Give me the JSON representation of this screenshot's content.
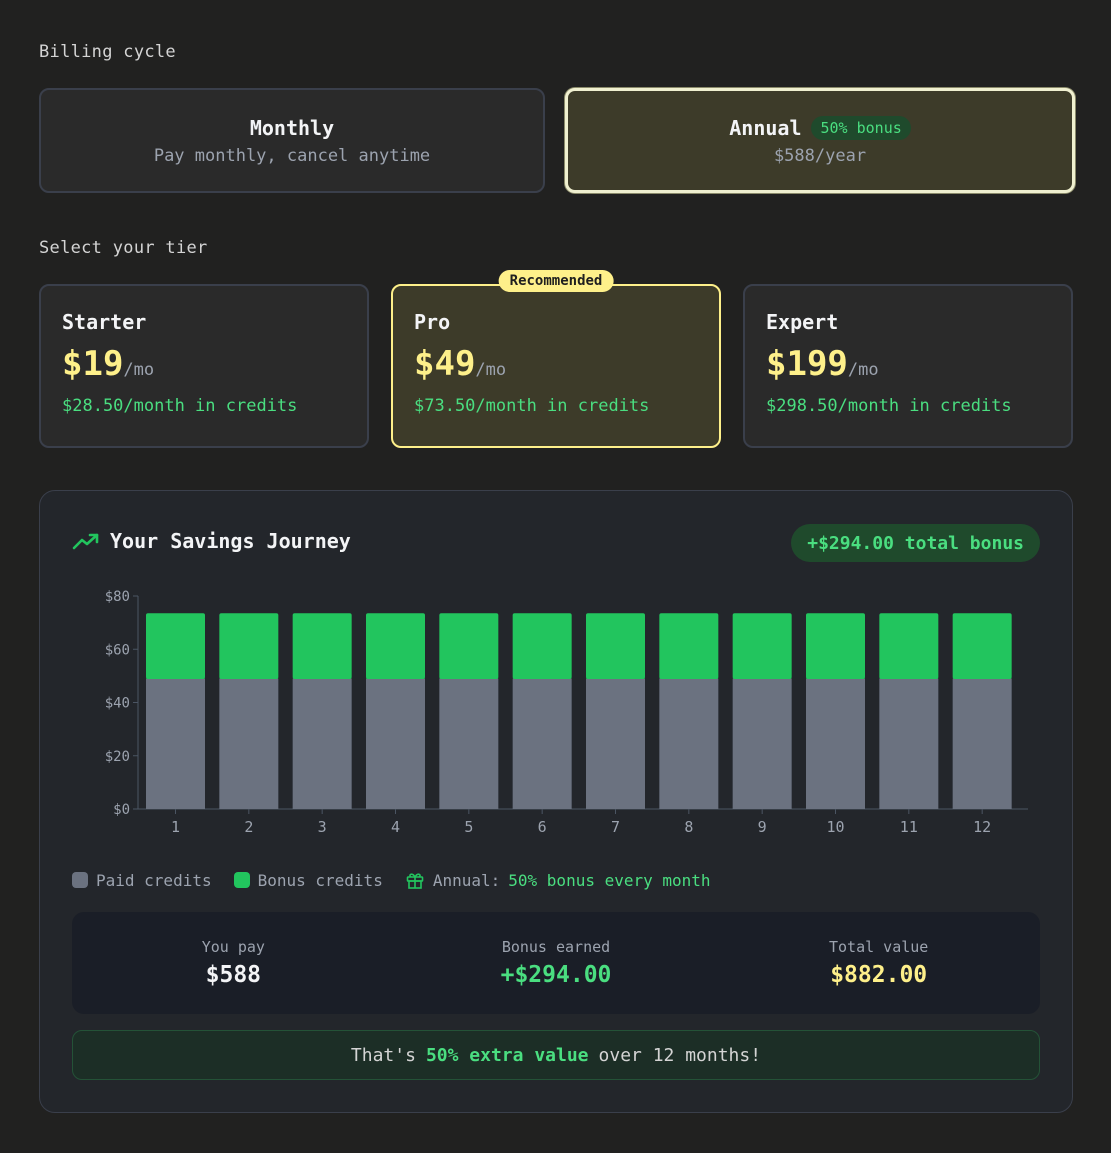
{
  "billing": {
    "label": "Billing cycle",
    "monthly": {
      "title": "Monthly",
      "subtitle": "Pay monthly, cancel anytime"
    },
    "annual": {
      "title": "Annual",
      "badge": "50% bonus",
      "subtitle": "$588/year"
    }
  },
  "tiers": {
    "label": "Select your tier",
    "recommended_badge": "Recommended",
    "items": [
      {
        "name": "Starter",
        "price": "$19",
        "per": "/mo",
        "credits": "$28.50/month in credits"
      },
      {
        "name": "Pro",
        "price": "$49",
        "per": "/mo",
        "credits": "$73.50/month in credits"
      },
      {
        "name": "Expert",
        "price": "$199",
        "per": "/mo",
        "credits": "$298.50/month in credits"
      }
    ]
  },
  "savings": {
    "title": "Your Savings Journey",
    "total_badge": "+$294.00 total bonus",
    "legend": {
      "paid": "Paid credits",
      "bonus": "Bonus credits",
      "annual_prefix": "Annual:",
      "annual_highlight": "50% bonus every month"
    },
    "summary": {
      "you_pay_label": "You pay",
      "you_pay_value": "$588",
      "bonus_label": "Bonus earned",
      "bonus_value": "+$294.00",
      "total_label": "Total value",
      "total_value": "$882.00"
    },
    "banner": {
      "prefix": "That's",
      "highlight": "50% extra value",
      "suffix": "over 12 months!"
    }
  },
  "colors": {
    "paid": "#6b7280",
    "bonus": "#22c55e",
    "accent": "#fef08a",
    "green_text": "#4ade80"
  },
  "chart_data": {
    "type": "bar",
    "stacked": true,
    "categories": [
      "1",
      "2",
      "3",
      "4",
      "5",
      "6",
      "7",
      "8",
      "9",
      "10",
      "11",
      "12"
    ],
    "series": [
      {
        "name": "Paid credits",
        "values": [
          49,
          49,
          49,
          49,
          49,
          49,
          49,
          49,
          49,
          49,
          49,
          49
        ]
      },
      {
        "name": "Bonus credits",
        "values": [
          24.5,
          24.5,
          24.5,
          24.5,
          24.5,
          24.5,
          24.5,
          24.5,
          24.5,
          24.5,
          24.5,
          24.5
        ]
      }
    ],
    "ylim": [
      0,
      80
    ],
    "yticks": [
      "$0",
      "$20",
      "$40",
      "$60",
      "$80"
    ],
    "ytick_values": [
      0,
      20,
      40,
      60,
      80
    ],
    "grid": false,
    "legend": "bottom-left"
  }
}
